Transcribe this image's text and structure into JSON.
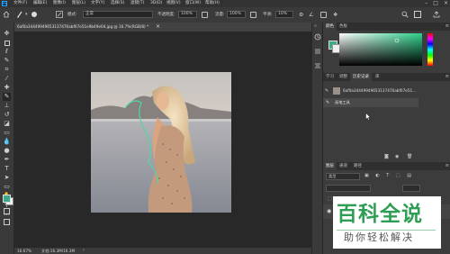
{
  "menubar": {
    "logo": "Ps",
    "items": [
      "文件(F)",
      "编辑(E)",
      "图像(I)",
      "图层(L)",
      "文字(Y)",
      "选择(S)",
      "滤镜(T)",
      "3D(D)",
      "视图(V)",
      "窗口(W)",
      "帮助(H)"
    ]
  },
  "options": {
    "mode_label": "模式:",
    "mode_value": "正常",
    "opacity_label": "不透明度:",
    "opacity_value": "100%",
    "flow_label": "流量:",
    "flow_value": "100%",
    "smooth_label": "平滑:",
    "smooth_value": "10%"
  },
  "document": {
    "tab_title": "6af0a34449949653137476abf07e51e9b49e04.jpg @ 16.7%(RGB/8) *",
    "close_glyph": "×"
  },
  "status": {
    "zoom": "16.67%",
    "doc_info": "文档:16.3M/16.3M"
  },
  "panels": {
    "color_tabs": [
      "颜色",
      "色板"
    ],
    "history_tabs": [
      "学习",
      "调整",
      "历史记录",
      "库"
    ],
    "history_items": [
      "6af0a34449949653137476abf07e51...",
      "画笔工具"
    ],
    "layers_tabs": [
      "图层",
      "通道",
      "路径"
    ],
    "layer_kind": "类型"
  },
  "watermark": {
    "title": "百科全说",
    "subtitle": "助你轻松解决"
  },
  "colors": {
    "foreground": "#3aaa8a",
    "background": "#f0f0f0",
    "spectrum_pick": "#66c0a0",
    "watermark_green": "#2f9e55",
    "brush_stroke": "#4fd6a6"
  },
  "icons": {
    "toolbar": [
      "move-icon",
      "marquee-icon",
      "lasso-icon",
      "quick-select-icon",
      "crop-icon",
      "eyedropper-icon",
      "healing-icon",
      "brush-icon",
      "clone-stamp-icon",
      "history-brush-icon",
      "eraser-icon",
      "gradient-icon",
      "blur-icon",
      "dodge-icon",
      "pen-icon",
      "type-icon",
      "path-select-icon",
      "rectangle-icon",
      "hand-icon",
      "zoom-icon",
      "more-icon"
    ]
  }
}
